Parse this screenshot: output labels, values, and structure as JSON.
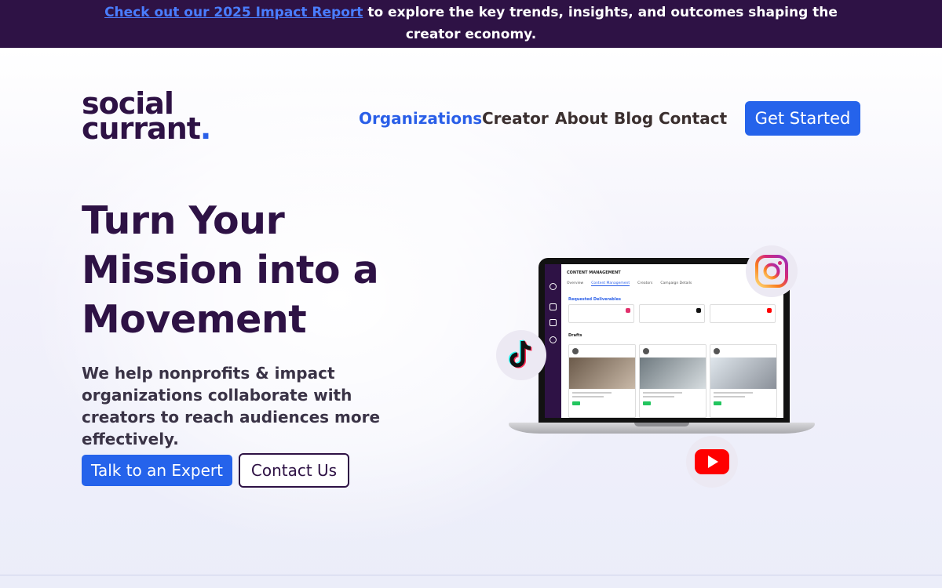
{
  "announcement": {
    "link_text": "Check out our 2025 Impact Report",
    "rest_text": " to explore the key trends, insights, and outcomes shaping the creator economy."
  },
  "logo": {
    "line1": "social",
    "line2": "currant",
    "dot": "."
  },
  "nav": {
    "items": [
      {
        "label": "Organizations",
        "active": true
      },
      {
        "label": "Creator",
        "active": false
      },
      {
        "label": "About",
        "active": false
      },
      {
        "label": "Blog",
        "active": false
      },
      {
        "label": "Contact",
        "active": false
      }
    ],
    "cta_label": "Get Started"
  },
  "hero": {
    "headline_l1": "Turn Your",
    "headline_l2": "Mission into a",
    "headline_l3": "Movement",
    "subtext": "We help nonprofits & impact organizations collaborate with creators to reach audiences more effectively.",
    "primary_button": "Talk to an Expert",
    "secondary_button": "Contact Us"
  },
  "mockup": {
    "header": "CONTENT MANAGEMENT",
    "tabs": [
      "Overview",
      "Content Management",
      "Creators",
      "Campaign Details"
    ],
    "section_title": "Requested Deliverables",
    "drafts_label": "Drafts"
  },
  "social_icons": [
    "instagram-icon",
    "tiktok-icon",
    "youtube-icon"
  ],
  "colors": {
    "brand_purple": "#2e1245",
    "brand_blue": "#2563eb",
    "link_blue": "#4a7dff"
  }
}
